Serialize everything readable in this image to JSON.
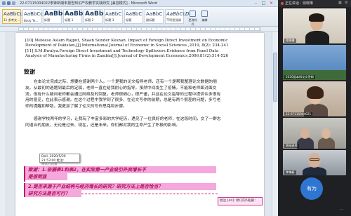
{
  "word": {
    "title": "22-07115004022李锋新期末报告知识产权教学实践研究 [兼容模式] - Microsoft Word",
    "window_controls": [
      "–",
      "□",
      "×"
    ],
    "styles": [
      {
        "sample": "AaBbCcDc",
        "name": "11 参考文..."
      },
      {
        "sample": "AaBbCcDc",
        "name": "Body Te..."
      },
      {
        "sample": "AaBbC",
        "name": "标题"
      },
      {
        "sample": "AaBbC",
        "name": "标题 1"
      },
      {
        "sample": "AaBbC",
        "name": "标题 2"
      },
      {
        "sample": "AaBbC",
        "name": "标题 3"
      },
      {
        "sample": "AaBbC",
        "name": "标题"
      },
      {
        "sample": "AaBbC",
        "name": "副标题"
      },
      {
        "sample": "AaBbCcDc",
        "name": "不明显强调"
      }
    ],
    "ribbon_buttons": [
      "更改样式",
      "编辑"
    ]
  },
  "doc": {
    "ref_lines": [
      "[10] Meleeso Aslam Rajput, Shaan Sunder Kesnan. Impact of Foreign Direct Investment on Economic",
      "Development of Pakistan,[J] International Journal of Economic in Social Sciences ,2019, 8(2): 234-241",
      "[11] S.M.Bwalya.Foreign Direct Investment and Technology Spillovers:Evidence from Panel Data",
      "Analysis of Manufacturing Firms in Zambia[J].Journal of Development Economics,2006,81(2):514-526"
    ],
    "heading": "致谢",
    "para1": "在本论文完成之际，想要在感谢两个人。一个是我的论文指导老师，还有一个是帮我整理论文数据的朋友。从最初的选题到最后的定稿，老师一直在给我耐心的指导。虽然中间发生了疫情，不能和老师面对面交流，但有什么疑问老师都会通过网络及时回复。老师很细心，很严谨，并且在论文指导的过程中提供许多很有用的意见，在此表示感谢。在这个过程中我学到了很多，在论文写作的前期，总是有两个很差的问题，多亏老师的提醒和帮助，我更加了解了论文的写作思路和步骤。",
    "para2": "感谢学校两年的学习，让我有了丰富多彩的大学经历，遇见了一位良好的老师，在这段时间，交了一群志同道合的朋友，无论是过去、现在，还是未来，你们都对我的生命产生了积极的影响。",
    "comment_tag": {
      "line1": "Dell, 2020/5/20 21:53:00 批注:",
      "line2": "格式已设置"
    },
    "highlight1": "致谢：1.依据表1和表2，在实际第一产业吸引外资的增长，为什么不占主导的来源？",
    "highlight2": "2.如果产业能够融合提升？是否考虑过研究方法？",
    "highlight_full": [
      "致谢：1.依据表1和表2，在实际第一产业吸引外资增长不",
      "是很明显",
      "2.是否来源于产业结构与经济增长的研究？研究方法上是否恰当？",
      "研究方法是否可行？"
    ],
    "balloon": "批注 [d4]: 修订的5处删："
  },
  "conf": {
    "top_label": "正在讲话：徐晓琳",
    "tiles": [
      {
        "name": "徐晓琳"
      },
      {
        "name": "2020届本科论文答辩"
      },
      {
        "name": "22-07115004021"
      },
      {
        "name": "答辩老师"
      },
      {
        "name": "李锋新"
      }
    ],
    "avatar_text": "有为",
    "more": "···"
  },
  "colors": {
    "highlight": "#f5a8dc",
    "highlight_text": "#b0125a",
    "avatar_blue": "#2f76d2"
  }
}
